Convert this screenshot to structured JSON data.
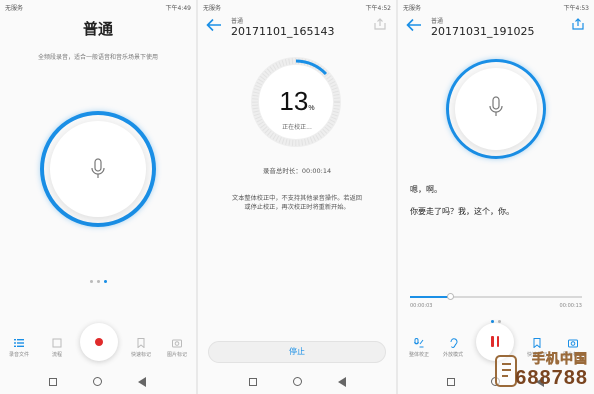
{
  "screens": [
    {
      "status": {
        "carrier": "无服务",
        "time": "下午4:49"
      },
      "title": "普通",
      "hint": "全频段录音，适合一般语音和音乐场景下使用",
      "pager_dots": 3,
      "tools": [
        {
          "label": "录音文件",
          "icon": "list-icon"
        },
        {
          "label": "流程",
          "icon": "square-icon"
        },
        {
          "label": "快速标记",
          "icon": "bookmark-icon"
        },
        {
          "label": "图片标记",
          "icon": "camera-icon"
        }
      ]
    },
    {
      "status": {
        "carrier": "无服务",
        "time": "下午4:52"
      },
      "header_sub": "普通",
      "header_title": "20171101_165143",
      "progress_value": "13",
      "progress_unit": "%",
      "progress_fraction": 0.13,
      "progress_status": "正在校正...",
      "record_duration": "录音总时长：00:00:14",
      "notice_line1": "文本整体校正中，不支持其他录音操作。若返回",
      "notice_line2": "或停止校正，再次校正时将重新开始。",
      "stop_label": "停止"
    },
    {
      "status": {
        "carrier": "无服务",
        "time": "下午4:53"
      },
      "header_sub": "普通",
      "header_title": "20171031_191025",
      "transcript_line1": "嗯，啊。",
      "transcript_line2": "你要走了吗？我，这个，你。",
      "time_current": "00:00:03",
      "time_total": "00:00:13",
      "playback_fraction": 0.23,
      "tools": [
        {
          "label": "整体校正",
          "icon": "voice-text-icon"
        },
        {
          "label": "外放模式",
          "icon": "ear-icon"
        },
        {
          "label": "快速标记",
          "icon": "bookmark-icon"
        },
        {
          "label": "图片标记",
          "icon": "camera-icon"
        }
      ]
    }
  ],
  "watermark": {
    "site_name": "手机中国",
    "number": "688788"
  },
  "colors": {
    "accent": "#1a8fe6",
    "record_red": "#e02b2b"
  }
}
